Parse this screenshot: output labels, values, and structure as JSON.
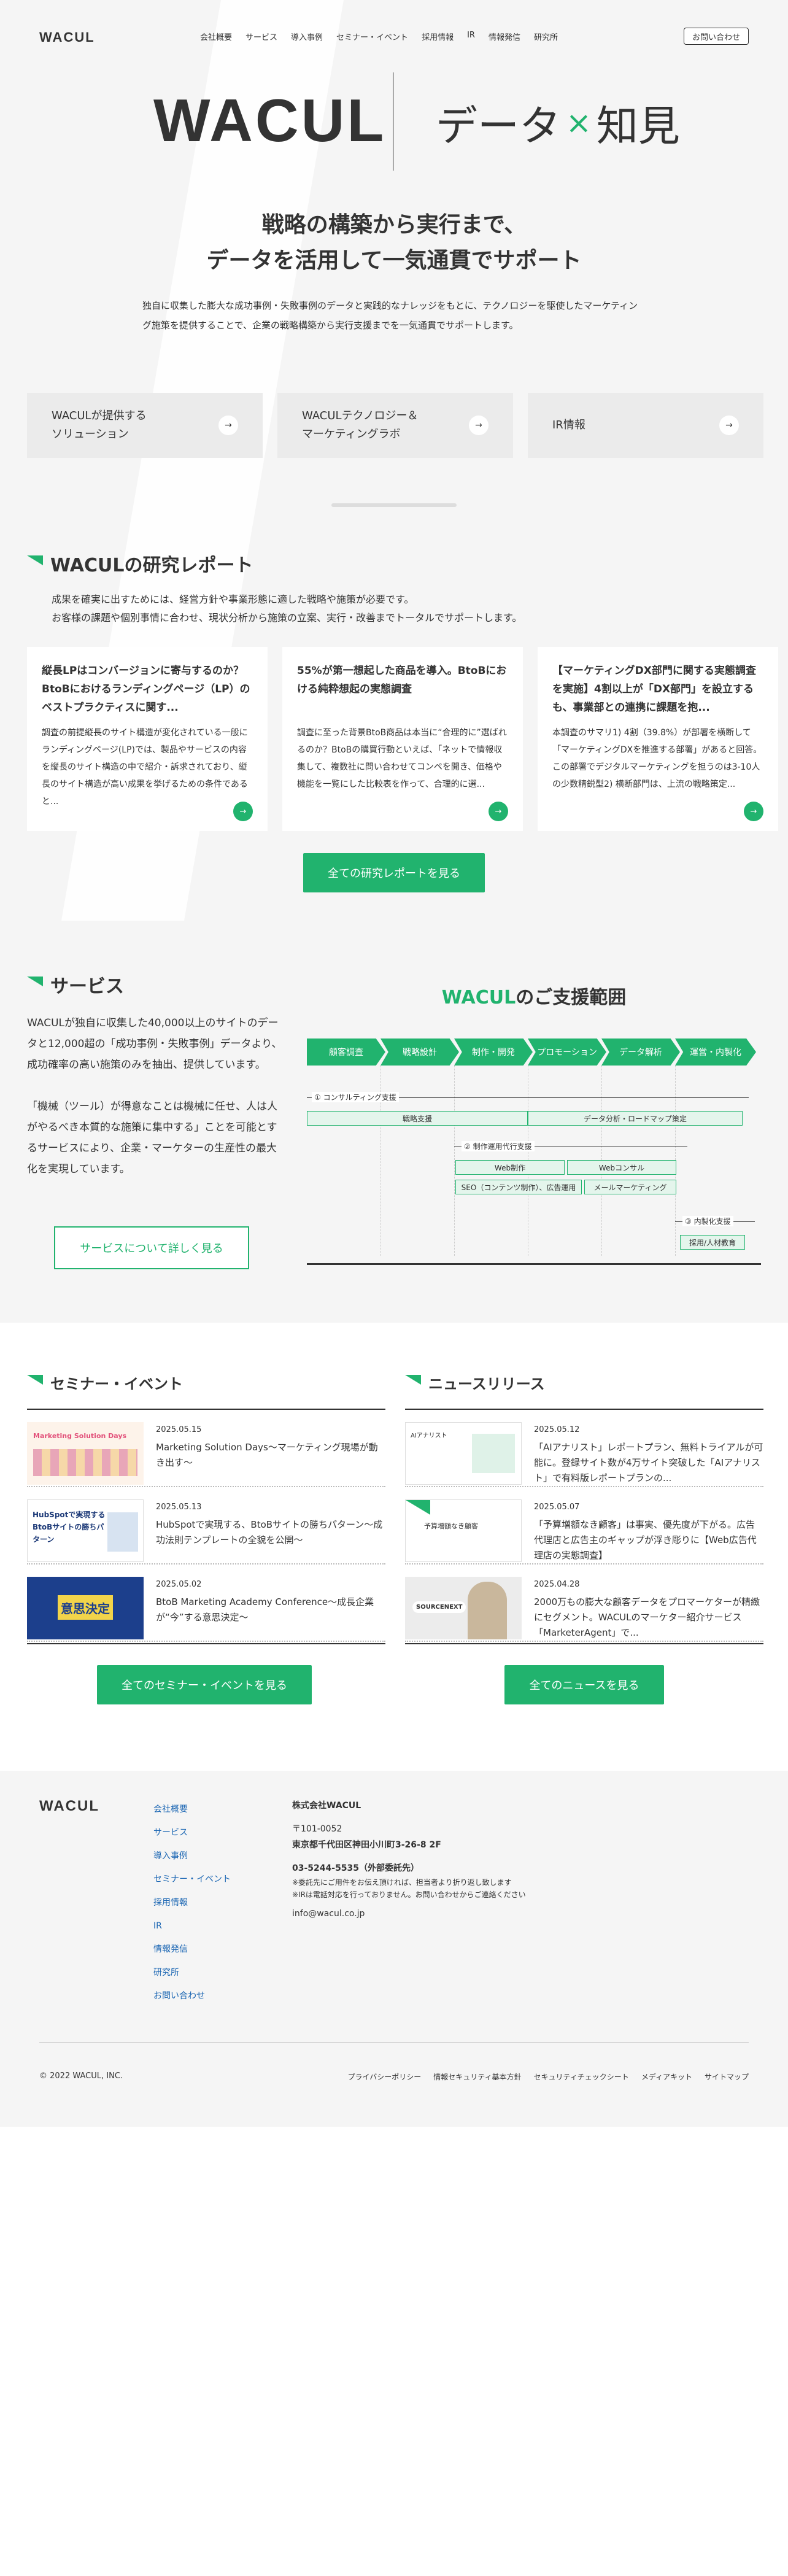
{
  "nav": {
    "logo": "WACUL",
    "items": [
      "会社概要",
      "サービス",
      "導入事例",
      "セミナー・イベント",
      "採用情報",
      "IR",
      "情報発信",
      "研究所"
    ],
    "contact": "お問い合わせ"
  },
  "hero": {
    "logo": "WACUL",
    "right_1": "データ",
    "right_x": "×",
    "right_2": "知見",
    "title_1": "戦略の構築から実行まで、",
    "title_2": "データを活用して一気通貫でサポート",
    "desc": "独自に収集した膨大な成功事例・失敗事例のデータと実践的なナレッジをもとに、テクノロジーを駆使したマーケティング施策を提供することで、企業の戦略構築から実行支援までを一気通貫でサポートします。"
  },
  "links": [
    {
      "label_1": "WACULが提供する",
      "label_2": "ソリューション"
    },
    {
      "label_1": "WACULテクノロジー＆",
      "label_2": "マーケティングラボ"
    },
    {
      "label_1": "IR情報",
      "label_2": ""
    }
  ],
  "research": {
    "title": "WACULの研究レポート",
    "desc_1": "成果を確実に出すためには、経営方針や事業形態に適した戦略や施策が必要です。",
    "desc_2": "お客様の課題や個別事情に合わせ、現状分析から施策の立案、実行・改善までトータルでサポートします。",
    "cards": [
      {
        "title": "縦長LPはコンバージョンに寄与するのか？BtoBにおけるランディングページ（LP）のベストプラクティスに関す...",
        "body": "調査の前提縦長のサイト構造が変化されている一般にランディングページ(LP)では、製品やサービスの内容を縦長のサイト構造の中で紹介・訴求されており、縦長のサイト構造が高い成果を挙げるための条件であると..."
      },
      {
        "title": "55%が第一想起した商品を導入。BtoBにおける純粋想起の実態調査",
        "body": "調査に至った背景BtoB商品は本当に“合理的に”選ばれるのか？BtoBの購買行動といえば、「ネットで情報収集して、複数社に問い合わせてコンペを開き、価格や機能を一覧にした比較表を作って、合理的に選..."
      },
      {
        "title": "【マーケティングDX部門に関する実態調査を実施】4割以上が「DX部門」を設立する も、事業部との連携に課題を抱...",
        "body": "本調査のサマリ1) 4割（39.8%）が部署を横断して「マーケティングDXを推進する部署」があると回答。この部署でデジタルマーケティングを担うのは3-10人の少数精鋭型2) 横断部門は、上流の戦略策定..."
      }
    ],
    "button": "全ての研究レポートを見る"
  },
  "service": {
    "title": "サービス",
    "desc_1": "WACULが独自に収集した40,000以上のサイトのデータと12,000超の「成功事例・失敗事例」データより、成功確率の高い施策のみを抽出、提供しています。",
    "desc_2": "「機械（ツール）が得意なことは機械に任せ、人は人がやるべき本質的な施策に集中する」ことを可能とするサービスにより、企業・マーケターの生産性の最大化を実現しています。",
    "button": "サービスについて詳しく見る"
  },
  "diagram": {
    "title_brand": "WACUL",
    "title_rest": "のご支援範囲",
    "steps": [
      "顧客調査",
      "戦略設計",
      "制作・開発",
      "プロモーション",
      "データ解析",
      "運営・内製化"
    ],
    "consult": "① コンサルティング支援",
    "strategy": "戦略支援",
    "data_road": "データ分析・ロードマップ策定",
    "agency": "② 制作運用代行支援",
    "web_prod": "Web制作",
    "web_consul": "Webコンサル",
    "seo": "SEO（コンテンツ制作）、広告運用",
    "mail": "メールマーケティング",
    "inhouse": "③ 内製化支援",
    "hire": "採用/人材教育"
  },
  "seminar": {
    "title": "セミナー・イベント",
    "items": [
      {
        "date": "2025.05.15",
        "text": "Marketing Solution Days〜マーケティング現場が動き出す〜",
        "thumb": "Marketing Solution Days"
      },
      {
        "date": "2025.05.13",
        "text": "HubSpotで実現する、BtoBサイトの勝ちパターン〜成功法則テンプレートの全貌を公開〜",
        "thumb": "HubSpotで実現する BtoBサイトの勝ちパターン"
      },
      {
        "date": "2025.05.02",
        "text": "BtoB Marketing Academy Conference〜成長企業が“今”する意思決定〜",
        "thumb": "意思決定"
      }
    ],
    "button": "全てのセミナー・イベントを見る"
  },
  "news": {
    "title": "ニュースリリース",
    "items": [
      {
        "date": "2025.05.12",
        "text": "「AIアナリスト」レポートプラン、無料トライアルが可能に。登録サイト数が4万サイト突破した「AIアナリスト」で有料版レポートプランの...",
        "thumb": "AIアナリスト"
      },
      {
        "date": "2025.05.07",
        "text": "「予算増額なき顧客」は事実、優先度が下がる。広告代理店と広告主のギャップが浮き彫りに【Web広告代理店の実態調査】",
        "thumb": "予算増額なき顧客"
      },
      {
        "date": "2025.04.28",
        "text": "2000万もの膨大な顧客データをプロマーケターが精緻にセグメント。WACULのマーケター紹介サービス「MarketerAgent」で...",
        "thumb": "SOURCENEXT"
      }
    ],
    "button": "全てのニュースを見る"
  },
  "footer": {
    "logo": "WACUL",
    "links": [
      "会社概要",
      "サービス",
      "導入事例",
      "セミナー・イベント",
      "採用情報",
      "IR",
      "情報発信",
      "研究所",
      "お問い合わせ"
    ],
    "company": "株式会社WACUL",
    "zip": "〒101-0052",
    "addr": "東京都千代田区神田小川町3-26-8 2F",
    "tel": "03-5244-5535（外部委託先）",
    "note_1": "※委託先にご用件をお伝え頂ければ、担当者より折り返し致します",
    "note_2": "※IRは電話対応を行っておりません。お問い合わせからご連絡ください",
    "email": "info@wacul.co.jp",
    "copy": "© 2022 WACUL, INC.",
    "bottom": [
      "プライバシーポリシー",
      "情報セキュリティ基本方針",
      "セキュリティチェックシート",
      "メディアキット",
      "サイトマップ"
    ]
  },
  "colors": {
    "accent": "#21b36e",
    "text": "#333333",
    "bg": "#f5f5f5"
  }
}
